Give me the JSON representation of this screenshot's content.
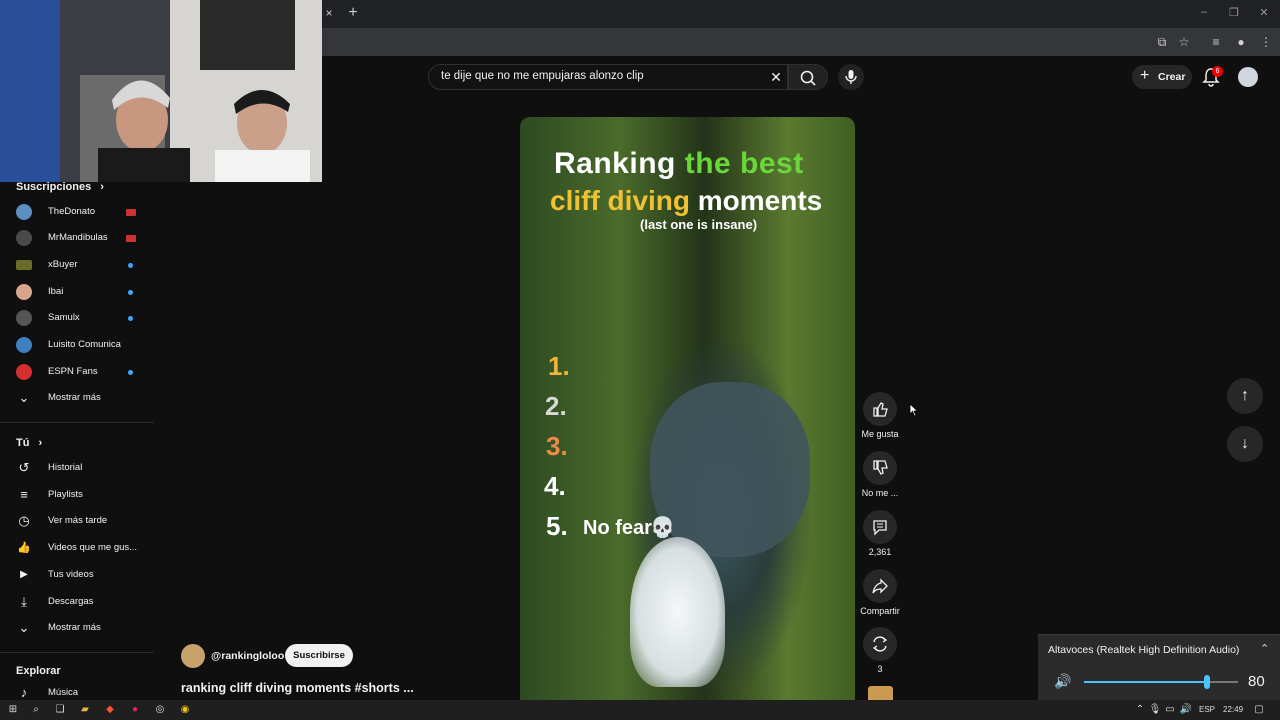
{
  "browser": {
    "tab_close": "×",
    "tab_new": "+",
    "window_controls": [
      "–",
      "❐",
      "✕"
    ],
    "toolbar_icons": [
      "cast-icon",
      "star-icon",
      "playlist-icon",
      "profile-icon",
      "menu-icon"
    ]
  },
  "search": {
    "query": "te dije que no me empujaras alonzo clip",
    "clear_glyph": "✕"
  },
  "header": {
    "create_label": "Crear",
    "notification_count": "6"
  },
  "sidebar": {
    "subscriptions_title": "Suscripciones",
    "subscriptions": [
      {
        "label": "TheDonato",
        "color": "#5b8fc2",
        "status": "live"
      },
      {
        "label": "MrMandibulas",
        "color": "#4a4a4a",
        "status": "live"
      },
      {
        "label": "xBuyer",
        "color": "#6b6b2a",
        "status": "new"
      },
      {
        "label": "Ibai",
        "color": "#d9a58c",
        "status": "new"
      },
      {
        "label": "Samulx",
        "color": "#555555",
        "status": "new"
      },
      {
        "label": "Luisito Comunica",
        "color": "#3f7fbf",
        "status": "none"
      },
      {
        "label": "ESPN Fans",
        "color": "#d32f2f",
        "status": "new"
      }
    ],
    "show_more_1": "Mostrar más",
    "you_title": "Tú",
    "you_items": [
      {
        "label": "Historial",
        "icon": "history-icon",
        "glyph": "↺"
      },
      {
        "label": "Playlists",
        "icon": "playlists-icon",
        "glyph": "≡"
      },
      {
        "label": "Ver más tarde",
        "icon": "watch-later-icon",
        "glyph": "◷"
      },
      {
        "label": "Videos que me gus...",
        "icon": "liked-videos-icon",
        "glyph": "👍"
      },
      {
        "label": "Tus videos",
        "icon": "your-videos-icon",
        "glyph": "▶"
      },
      {
        "label": "Descargas",
        "icon": "downloads-icon",
        "glyph": "⤓"
      }
    ],
    "show_more_2": "Mostrar más",
    "explore_title": "Explorar",
    "explore_items": [
      {
        "label": "Música",
        "icon": "music-icon",
        "glyph": "♪"
      }
    ]
  },
  "video": {
    "overlay_title_word1": "Ranking",
    "overlay_title_word2": "the best",
    "overlay_title_word3": "cliff diving",
    "overlay_title_word4": "moments",
    "overlay_subtitle": "(last one is insane)",
    "ranks": [
      "1.",
      "2.",
      "3.",
      "4.",
      "5."
    ],
    "no_fear": "No fear",
    "skull": "💀"
  },
  "actions": {
    "like": "Me gusta",
    "dislike": "No me ...",
    "comments": "2,361",
    "share": "Compartir",
    "remix": "3"
  },
  "channel": {
    "handle": "@rankingloloo",
    "subscribe": "Suscribirse",
    "title": "ranking cliff diving moments #shorts  ..."
  },
  "volume": {
    "device": "Altavoces (Realtek High Definition Audio)",
    "level": 80
  },
  "taskbar": {
    "lang": "ESP",
    "time": "22:49"
  }
}
